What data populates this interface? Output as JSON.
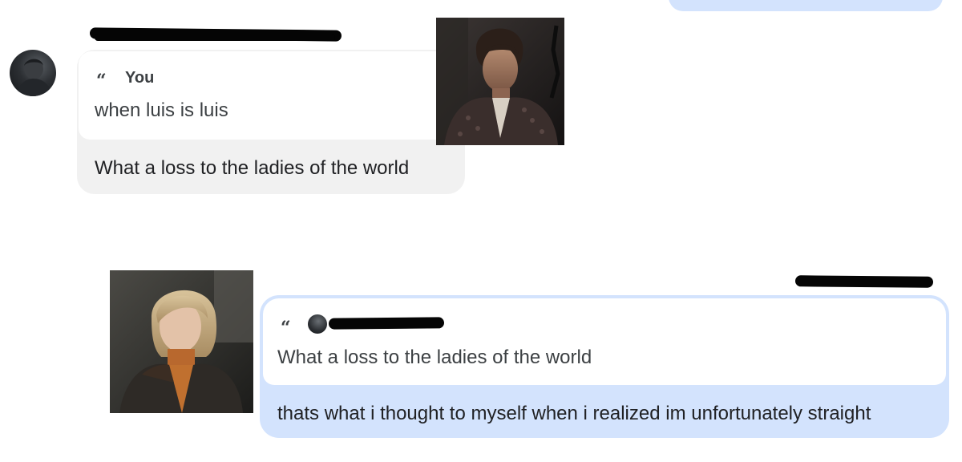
{
  "previous_message": {
    "bubble_color": "#d3e3fd"
  },
  "incoming": {
    "sender_name_redacted": true,
    "avatar": "profile-photo",
    "quote": {
      "author": "You",
      "text": "when luis is luis"
    },
    "text": "What a loss to the ladies of the world",
    "bubble_color": "#f1f1f1",
    "image": "luis-character-image"
  },
  "outgoing": {
    "timestamp_redacted": true,
    "quote": {
      "author_redacted": true,
      "text": "What a loss to the ladies of the world"
    },
    "text": "thats what i thought to myself when i realized im unfortunately straight",
    "bubble_color": "#d3e3fd",
    "image": "ashley-character-image"
  },
  "icons": {
    "quote": "“"
  }
}
